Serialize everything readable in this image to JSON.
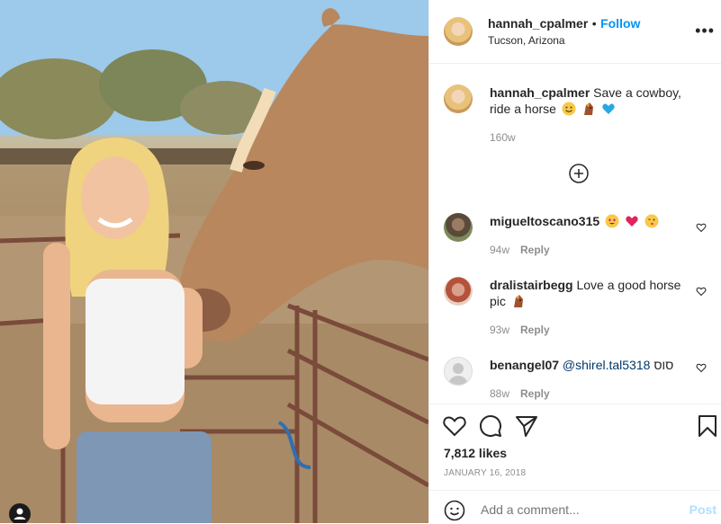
{
  "post": {
    "username": "hannah_cpalmer",
    "dot": "•",
    "follow_label": "Follow",
    "location": "Tucson, Arizona",
    "more_label": "•••"
  },
  "caption": {
    "username": "hannah_cpalmer",
    "text": "Save a cowboy, ride a horse",
    "age": "160w"
  },
  "comments": [
    {
      "username": "migueltoscano315",
      "text": "",
      "age": "94w",
      "reply_label": "Reply"
    },
    {
      "username": "dralistairbegg",
      "text": "Love a good horse pic",
      "age": "93w",
      "reply_label": "Reply"
    },
    {
      "username": "benangel07",
      "mention": "@shirel.tal5318",
      "text": "סוס",
      "age": "88w",
      "reply_label": "Reply"
    }
  ],
  "likes": "7,812 likes",
  "date": "JANUARY 16, 2018",
  "add_comment": {
    "placeholder": "Add a comment...",
    "post_label": "Post"
  },
  "icons": [
    "more-icon",
    "load-more-icon",
    "heart-icon",
    "comment-icon",
    "share-icon",
    "save-icon",
    "emoji-icon",
    "user-tag-icon"
  ],
  "colors": {
    "accent": "#0095f6",
    "text": "#262626",
    "muted": "#8e8e8e",
    "post_disabled": "#b2dffc"
  }
}
